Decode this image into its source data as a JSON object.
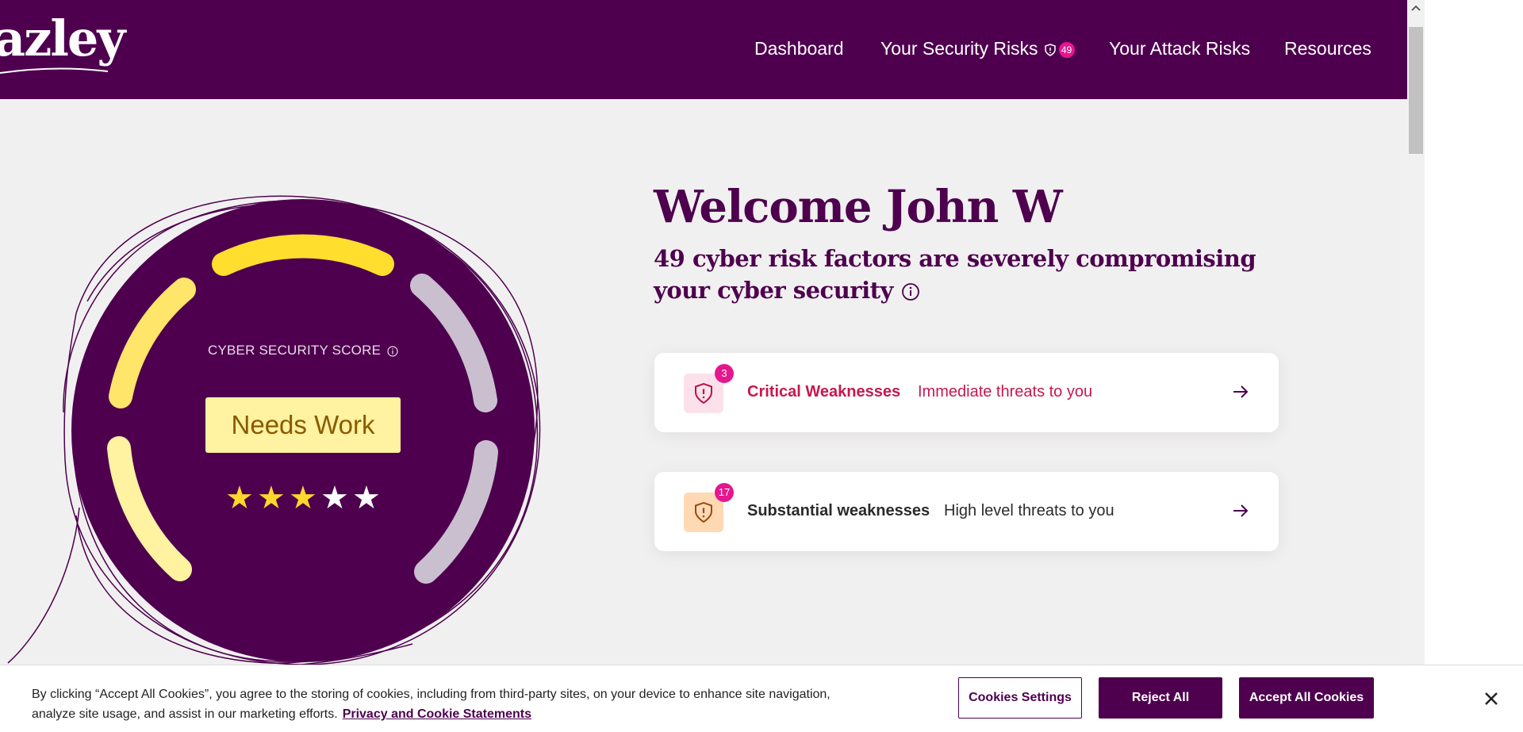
{
  "brand": {
    "logo_text": "azley"
  },
  "nav": {
    "dashboard": "Dashboard",
    "security_risks": "Your Security Risks",
    "security_risks_badge": "49",
    "attack_risks": "Your Attack Risks",
    "resources": "Resources"
  },
  "score": {
    "label": "CYBER SECURITY SCORE",
    "status": "Needs Work",
    "stars": {
      "filled": 3,
      "total": 5
    }
  },
  "welcome": {
    "title": "Welcome John W",
    "subtitle": "49 cyber risk factors are severely compromising your cyber security"
  },
  "cards": [
    {
      "count": "3",
      "title": "Critical Weaknesses",
      "description": "Immediate threats to you",
      "color": "#c8174f",
      "icon_bg": "#fde1ea",
      "icon": "shield-alert-icon"
    },
    {
      "count": "17",
      "title": "Substantial weaknesses",
      "description": "High level threats to you",
      "color": "#2b2b2b",
      "icon_bg": "#ffd9b3",
      "icon": "shield-alert-icon"
    }
  ],
  "cookie": {
    "text": "By clicking “Accept All Cookies”, you agree to the storing of cookies, including from third-party sites, on your device to enhance site navigation, analyze site usage, and assist in our marketing efforts.",
    "link": "Privacy and Cookie Statements",
    "settings": "Cookies Settings",
    "reject": "Reject All",
    "accept": "Accept All Cookies"
  },
  "colors": {
    "brand_purple": "#4e004f",
    "badge_pink": "#e5178c",
    "gauge_yellow": "#ffde2e",
    "gauge_light_yellow": "#fff2a0",
    "gauge_grey": "#c9bfcf"
  }
}
